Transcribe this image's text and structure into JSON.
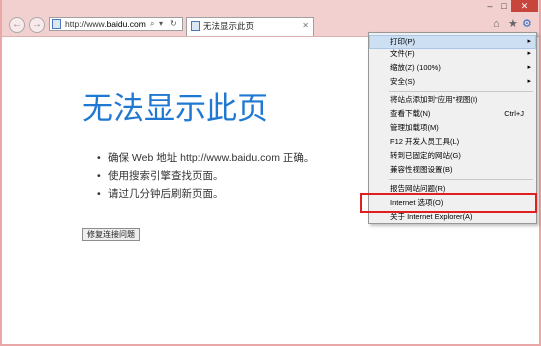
{
  "window": {
    "min_glyph": "–",
    "max_glyph": "□",
    "close_glyph": "✕"
  },
  "navbar": {
    "back_glyph": "←",
    "forward_glyph": "→",
    "address_prefix": "http://www.",
    "address_domain": "baidu.com",
    "search_glyph": "⌕",
    "dropdown_glyph": "▾",
    "refresh_glyph": "↻",
    "tab_title": "无法显示此页",
    "tab_close_glyph": "✕",
    "home_glyph": "⌂",
    "favorites_glyph": "★",
    "tools_glyph": "⚙"
  },
  "page": {
    "title": "无法显示此页",
    "tips": [
      "确保 Web 地址 http://www.baidu.com 正确。",
      "使用搜索引擎查找页面。",
      "请过几分钟后刷新页面。"
    ],
    "fix_button": "修复连接问题"
  },
  "menu": {
    "items": [
      {
        "label": "打印(P)",
        "arrow": "▸",
        "shortcut": ""
      },
      {
        "label": "文件(F)",
        "arrow": "▸",
        "shortcut": ""
      },
      {
        "label": "缩放(Z) (100%)",
        "arrow": "▸",
        "shortcut": ""
      },
      {
        "label": "安全(S)",
        "arrow": "▸",
        "shortcut": ""
      },
      {
        "label": "将站点添加到\"应用\"视图(I)",
        "arrow": "",
        "shortcut": ""
      },
      {
        "label": "查看下载(N)",
        "arrow": "",
        "shortcut": "Ctrl+J"
      },
      {
        "label": "管理加载项(M)",
        "arrow": "",
        "shortcut": ""
      },
      {
        "label": "F12 开发人员工具(L)",
        "arrow": "",
        "shortcut": ""
      },
      {
        "label": "转到已固定的网站(G)",
        "arrow": "",
        "shortcut": ""
      },
      {
        "label": "兼容性视图设置(B)",
        "arrow": "",
        "shortcut": ""
      },
      {
        "label": "报告网站问题(R)",
        "arrow": "",
        "shortcut": ""
      },
      {
        "label": "Internet 选项(O)",
        "arrow": "",
        "shortcut": ""
      },
      {
        "label": "关于 Internet Explorer(A)",
        "arrow": "",
        "shortcut": ""
      }
    ]
  },
  "colors": {
    "title_blue": "#1f78d1",
    "frame_pink": "#f2d0d0",
    "highlight_red": "#e0201e",
    "menu_hover": "#ccdff3"
  }
}
